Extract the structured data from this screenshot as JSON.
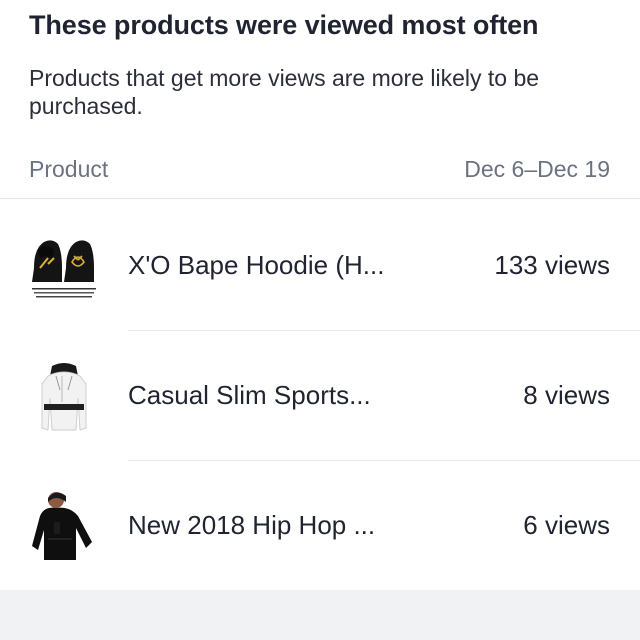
{
  "header": {
    "title": "These products were viewed most often",
    "subtitle": "Products that get more views are more likely to be purchased."
  },
  "table": {
    "columns": {
      "product": "Product",
      "range": "Dec 6–Dec 19"
    },
    "rows": [
      {
        "name": "X'O Bape Hoodie (H...",
        "views": "133 views",
        "thumb_icon": "black-hoodie-pair-image"
      },
      {
        "name": "Casual Slim Sports...",
        "views": "8 views",
        "thumb_icon": "white-hoodie-image"
      },
      {
        "name": "New 2018 Hip Hop ...",
        "views": "6 views",
        "thumb_icon": "black-hoodie-model-image"
      }
    ]
  },
  "colors": {
    "text_primary": "#1f2430",
    "text_secondary": "#6b7280",
    "divider": "#e3e5e8",
    "footer_bg": "#f1f2f4"
  }
}
